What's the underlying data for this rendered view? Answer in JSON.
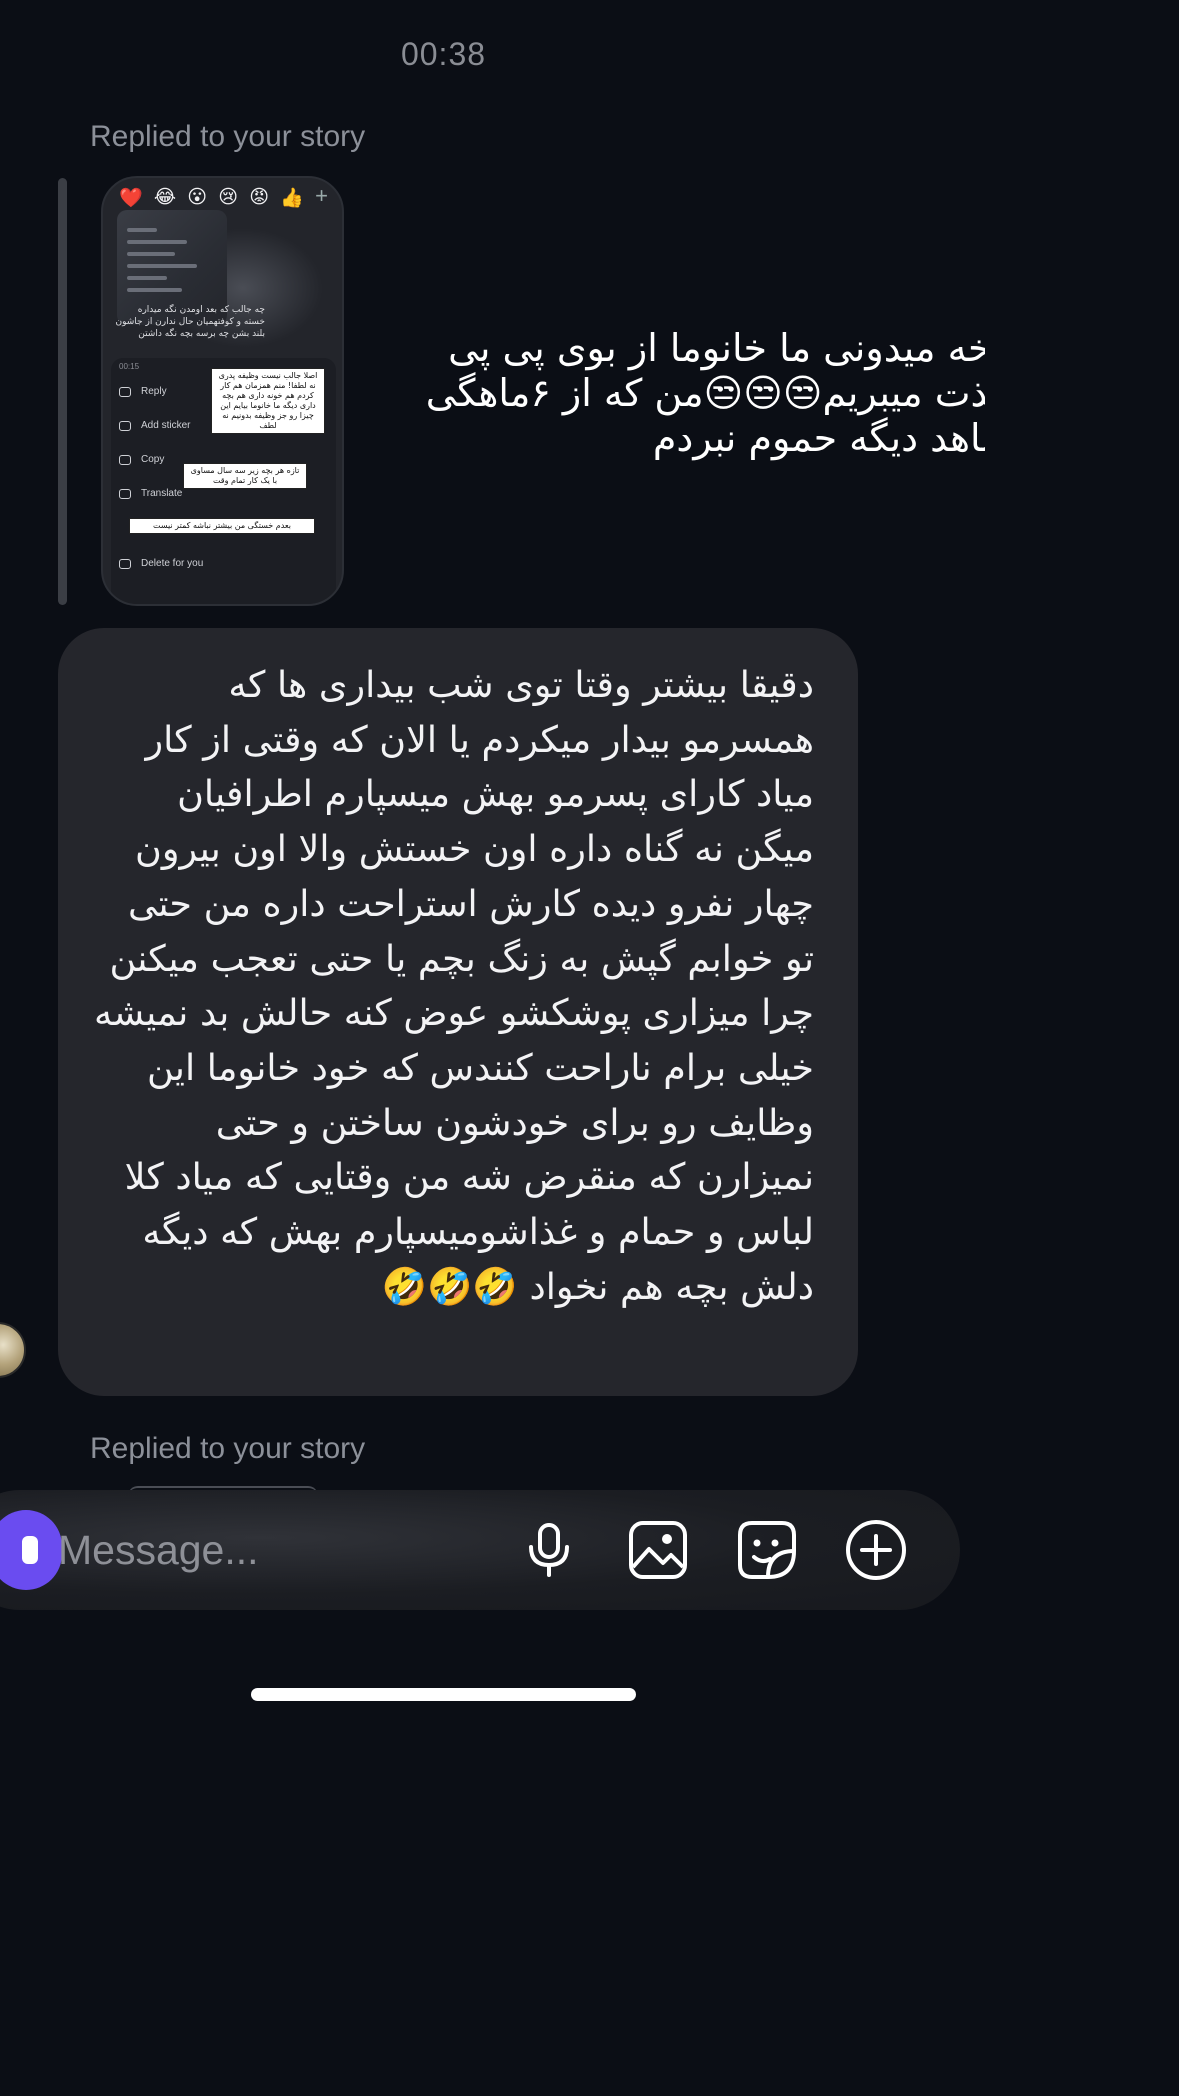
{
  "status": {
    "time": "00:38"
  },
  "replies": {
    "first_label": "Replied to your story",
    "second_label": "Replied to your story"
  },
  "story_thumb": {
    "reactions": [
      "❤️",
      "😂",
      "😮",
      "😢",
      "😡",
      "👍"
    ],
    "add_reaction": "+",
    "caption": "چه جالب که بعد اومدن نگه میداره خسته و کوفتهمیان حال ندارن از جاشون بلند بشن چه برسه بچه نگه داشتن",
    "menu_time": "00:15",
    "menu": [
      "Reply",
      "Add sticker",
      "Copy",
      "Translate",
      "Delete for you"
    ],
    "notes": [
      "اصلا جالب نیست وظیفه پدری نه لطفا! منم همزمان هم کار کردم هم خونه داری هم بچه داری دیگه ما خانوما بیایم این چیزا رو جز وظیفه بدونیم نه لطف",
      "تازه هر بچه زیر سه سال مساوی با یک کار تمام وقت",
      "بعدم خستگی من بیشتر نباشه کمتر نیست"
    ]
  },
  "messages": {
    "reply_text": "اخه میدونی ما خانوما از بوی پی پی لذت میبریم😒😒😒من که از ۶ماهگی ماهد دیگه حموم نبردم",
    "long_text": "دقیقا بیشتر وقتا توی شب بیداری ها که همسرمو بیدار میکردم یا الان که وقتی از کار میاد کارای پسرمو بهش میسپارم اطرافیان میگن نه گناه داره اون خستش والا اون بیرون چهار نفرو دیده کارش استراحت داره من حتی تو خوابم گپش به زنگ بچم یا حتی تعجب میکنن چرا میزاری پوشکشو عوض کنه حالش بد نمیشه خیلی برام ناراحت کنندس که خود خانوما این وظایف رو برای خودشون ساختن و حتی نمیزارن که منقرض شه من وقتایی که میاد کلا لباس و حمام و غذاشومیسپارم بهش که دیگه دلش بچه هم نخواد 🤣🤣🤣"
  },
  "composer": {
    "placeholder": "Message...",
    "icons": [
      "microphone-icon",
      "image-icon",
      "sticker-icon",
      "plus-circle-icon"
    ]
  },
  "colors": {
    "background": "#0b0e15",
    "bubble": "#25262c",
    "camera_button": "#6a4cf0",
    "meta_text": "#8c9099"
  }
}
